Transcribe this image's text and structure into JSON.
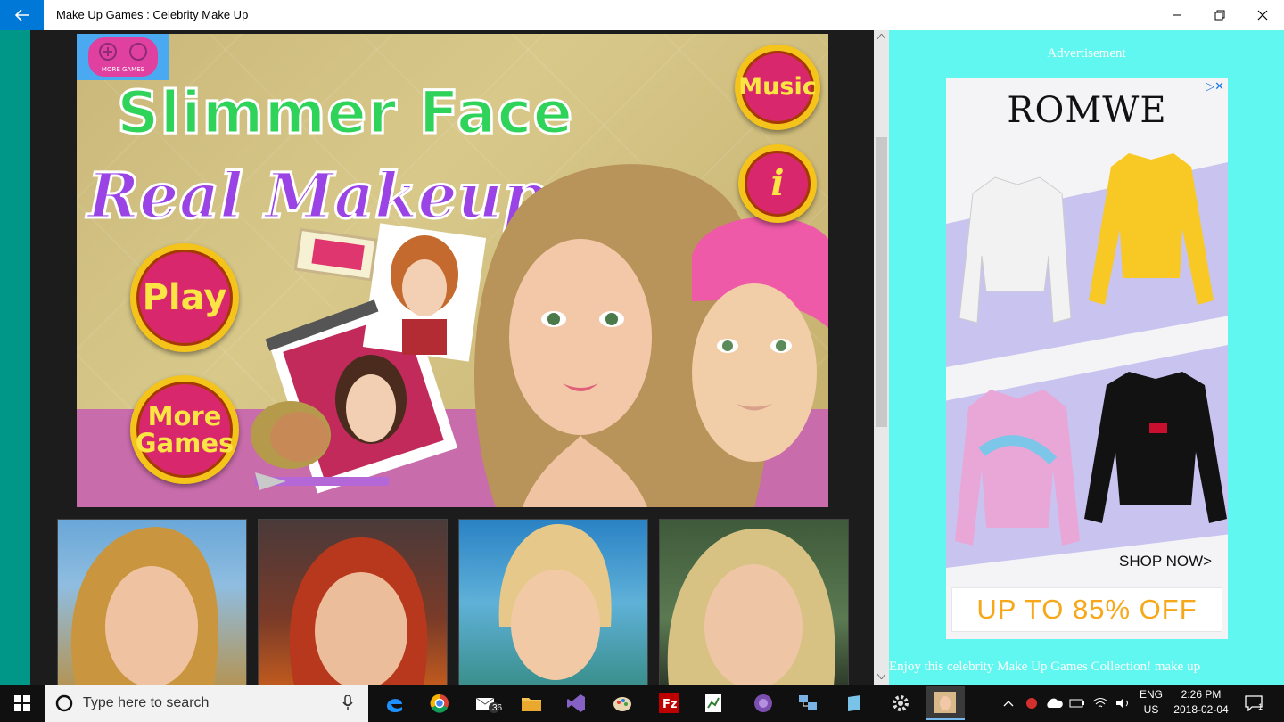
{
  "window": {
    "title": "Make Up Games : Celebrity Make Up"
  },
  "game_banner": {
    "title_line1": "Slimmer Face",
    "title_line2": "Real Makeup",
    "more_games_badge": "MORE GAMES",
    "play_label": "Play",
    "more_games_label_1": "More",
    "more_games_label_2": "Games",
    "music_label": "Music",
    "info_label": "i"
  },
  "sidebar": {
    "ad_label": "Advertisement",
    "ad": {
      "brand": "ROMWE",
      "shop_now": "SHOP NOW>",
      "offer": "UP TO 85% OFF",
      "accent": "#f6a81a"
    },
    "description": "Enjoy this celebrity Make Up Games Collection! make up"
  },
  "taskbar": {
    "search_placeholder": "Type here to search",
    "mail_badge": "36",
    "language_1": "ENG",
    "language_2": "US",
    "time": "2:26 PM",
    "date": "2018-02-04",
    "notification_count": "1"
  },
  "colors": {
    "back_button": "#0078d7",
    "left_gutter": "#009688",
    "sidebar_bg": "#5ff7f0",
    "button_pink": "#d9276d",
    "button_ring": "#f5c41a"
  }
}
